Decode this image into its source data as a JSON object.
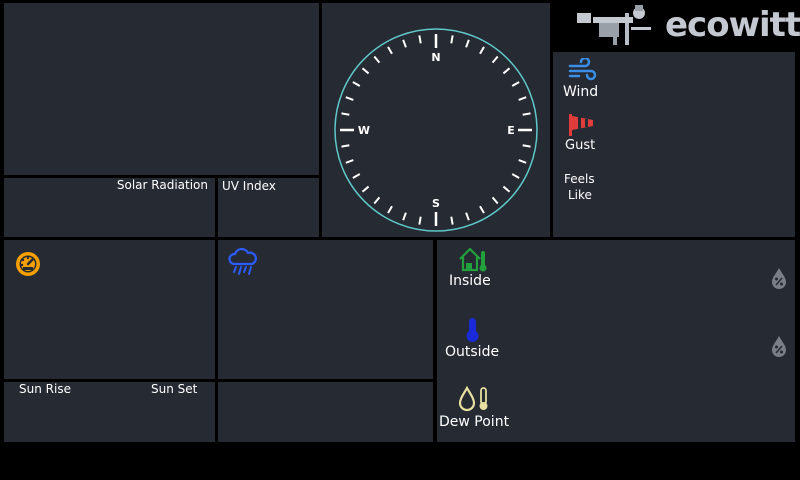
{
  "brand": {
    "name": "ecowitt",
    "logo_icon": "weather-station-icon"
  },
  "solar": {
    "solar_radiation_label": "Solar Radiation",
    "uv_index_label": "UV Index"
  },
  "compass": {
    "north": "N",
    "east": "E",
    "south": "S",
    "west": "W",
    "ring_color": "#5fc8c8"
  },
  "wind": {
    "wind_label": "Wind",
    "gust_label": "Gust",
    "feels_like_line1": "Feels",
    "feels_like_line2": "Like",
    "wind_icon_color": "#3a8ee6",
    "gust_icon_color": "#e03c3c"
  },
  "pressure": {
    "icon": "gauge-icon",
    "icon_color": "#f5a000"
  },
  "rain": {
    "icon": "rain-cloud-icon",
    "icon_color": "#2a5cff"
  },
  "sun": {
    "sun_rise_label": "Sun Rise",
    "sun_set_label": "Sun Set"
  },
  "temperature": {
    "inside_label": "Inside",
    "outside_label": "Outside",
    "dew_point_label": "Dew Point",
    "inside_icon_color": "#22a03c",
    "outside_icon_color": "#1a2ad8",
    "dew_icon_color": "#e8e0a0"
  }
}
